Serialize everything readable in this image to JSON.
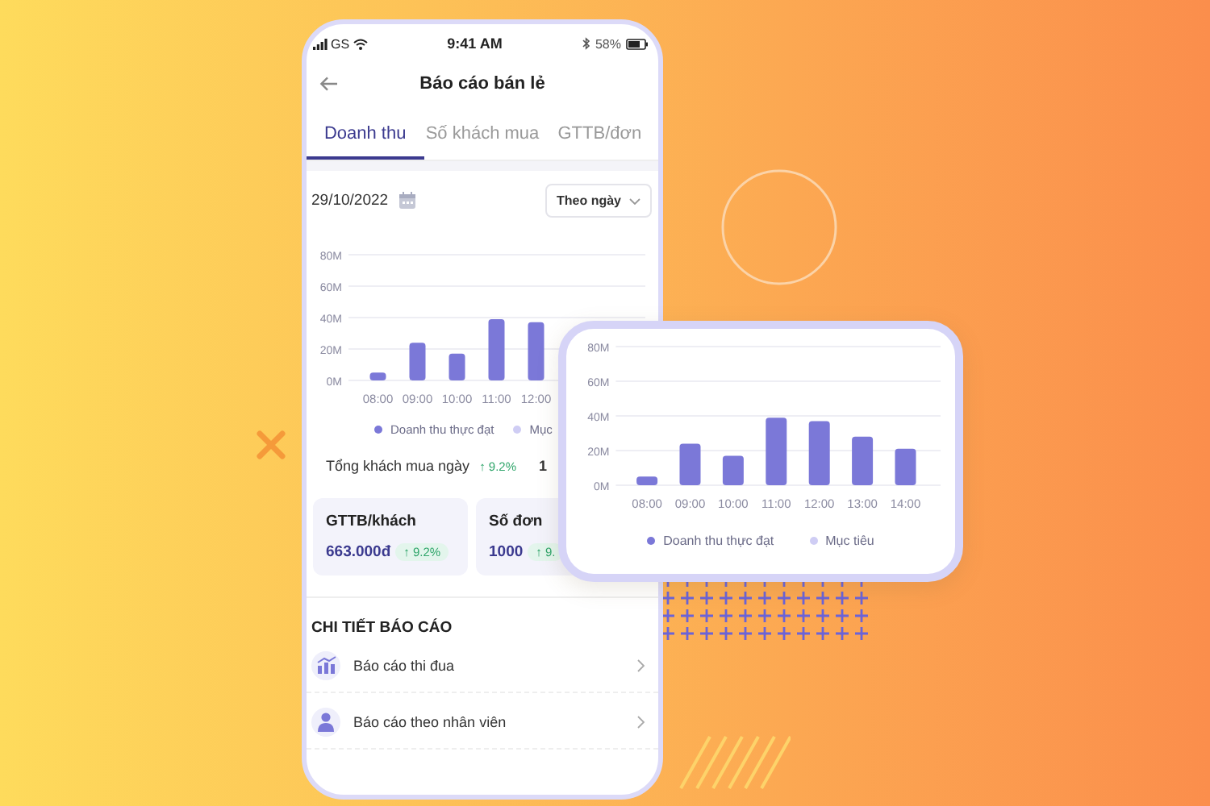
{
  "status_bar": {
    "carrier": "GS",
    "time": "9:41 AM",
    "battery": "58%"
  },
  "header": {
    "title": "Báo cáo bán lẻ"
  },
  "tabs": [
    {
      "label": "Doanh thu",
      "selected": true
    },
    {
      "label": "Số khách mua",
      "selected": false
    },
    {
      "label": "GTTB/đơn",
      "selected": false
    }
  ],
  "date": "29/10/2022",
  "period_dropdown": "Theo ngày",
  "chart": {
    "chart_data": {
      "type": "bar",
      "grid": true,
      "categories": [
        "08:00",
        "09:00",
        "10:00",
        "11:00",
        "12:00"
      ],
      "yticks": [
        {
          "value": 0,
          "label": "0M"
        },
        {
          "value": 20,
          "label": "20M"
        },
        {
          "value": 40,
          "label": "40M"
        },
        {
          "value": 60,
          "label": "60M"
        },
        {
          "value": 80,
          "label": "80M"
        }
      ],
      "ylim": [
        0,
        80
      ],
      "series": [
        {
          "name": "Doanh thu thực đạt",
          "color": "#7b78d8",
          "values": [
            5,
            24,
            17,
            39,
            37
          ]
        }
      ]
    },
    "legend": [
      {
        "label": "Mục",
        "color": "#cfcdf4"
      }
    ]
  },
  "summary": {
    "label": "Tổng khách mua ngày",
    "change": "↑ 9.2%",
    "value": "1"
  },
  "cards": [
    {
      "title": "GTTB/khách",
      "value": "663.000đ",
      "change": "↑ 9.2%"
    },
    {
      "title": "Số đơn",
      "value": "1000",
      "change": "↑ 9."
    }
  ],
  "section_title": "CHI TIẾT BÁO CÁO",
  "report_links": [
    {
      "kind": "chart",
      "label": "Báo cáo thi đua"
    },
    {
      "kind": "person",
      "label": "Báo cáo theo nhân viên"
    }
  ],
  "popup_chart": {
    "chart_data": {
      "type": "bar",
      "grid": true,
      "categories": [
        "08:00",
        "09:00",
        "10:00",
        "11:00",
        "12:00",
        "13:00",
        "14:00"
      ],
      "yticks": [
        {
          "value": 0,
          "label": "0M"
        },
        {
          "value": 20,
          "label": "20M"
        },
        {
          "value": 40,
          "label": "40M"
        },
        {
          "value": 60,
          "label": "60M"
        },
        {
          "value": 80,
          "label": "80M"
        }
      ],
      "ylim": [
        0,
        80
      ],
      "series": [
        {
          "name": "Doanh thu thực đạt",
          "color": "#7b78d8",
          "values": [
            5,
            24,
            17,
            39,
            37,
            28,
            21
          ]
        }
      ]
    },
    "legend": [
      {
        "label": "Mục tiêu",
        "color": "#cfcdf4"
      }
    ]
  }
}
